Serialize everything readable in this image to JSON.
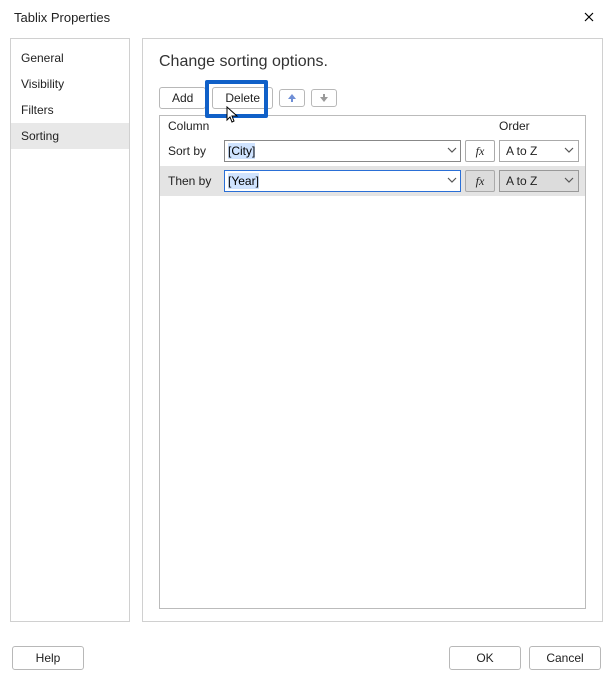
{
  "window": {
    "title": "Tablix Properties"
  },
  "sidebar": {
    "items": [
      {
        "label": "General"
      },
      {
        "label": "Visibility"
      },
      {
        "label": "Filters"
      },
      {
        "label": "Sorting",
        "active": true
      }
    ]
  },
  "main": {
    "heading": "Change sorting options.",
    "toolbar": {
      "add_label": "Add",
      "delete_label": "Delete",
      "fx_label": "fx"
    },
    "grid": {
      "column_header": "Column",
      "order_header": "Order",
      "rows": [
        {
          "label": "Sort by",
          "expression": "[City]",
          "order": "A to Z",
          "selected": false
        },
        {
          "label": "Then by",
          "expression": "[Year]",
          "order": "A to Z",
          "selected": true
        }
      ]
    }
  },
  "footer": {
    "help_label": "Help",
    "ok_label": "OK",
    "cancel_label": "Cancel"
  }
}
